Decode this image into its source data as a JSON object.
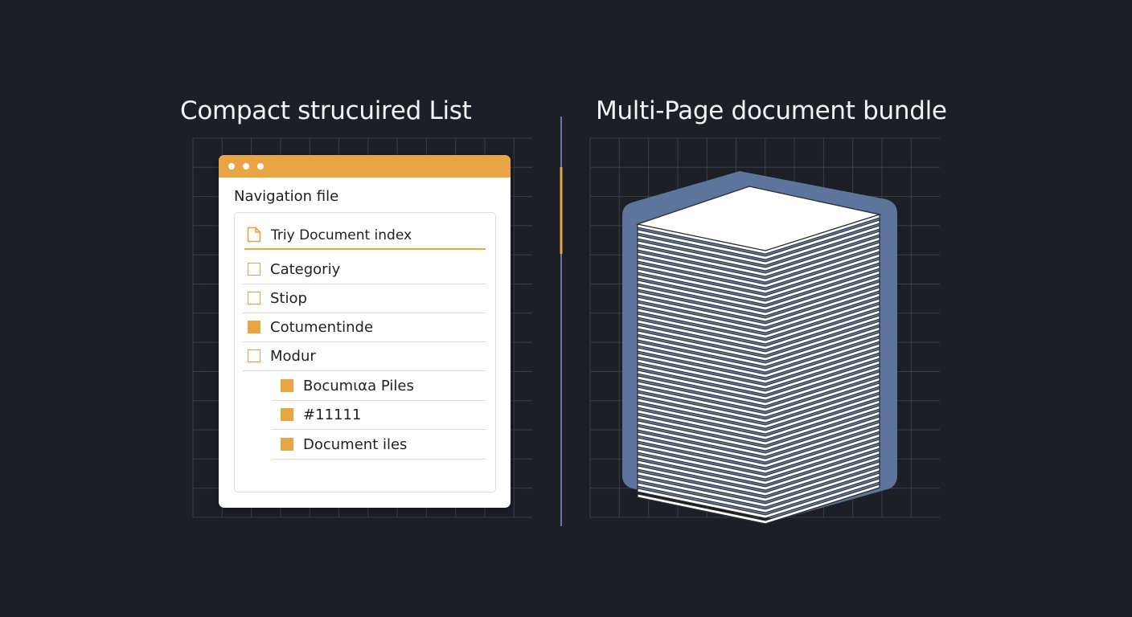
{
  "left_section": {
    "heading": "Compact strucuired List",
    "window": {
      "title": "Navigation file",
      "index_item": "Triy Document index",
      "items": [
        {
          "label": "Categoriy",
          "checked": false
        },
        {
          "label": "Stiop",
          "checked": false
        },
        {
          "label": "Cotumentinde",
          "checked": true
        },
        {
          "label": "Modur",
          "checked": false
        }
      ],
      "sub_items": [
        {
          "label": "Bocumιαa Piles",
          "checked": true
        },
        {
          "label": "#11111",
          "checked": true
        },
        {
          "label": "Document iles",
          "checked": true
        }
      ]
    }
  },
  "right_section": {
    "heading": "Multi-Page document bundle"
  },
  "colors": {
    "background": "#1c1f26",
    "accent": "#e9a443",
    "divider_blue": "#5f7ba6",
    "stack_backdrop": "#5d749c"
  }
}
